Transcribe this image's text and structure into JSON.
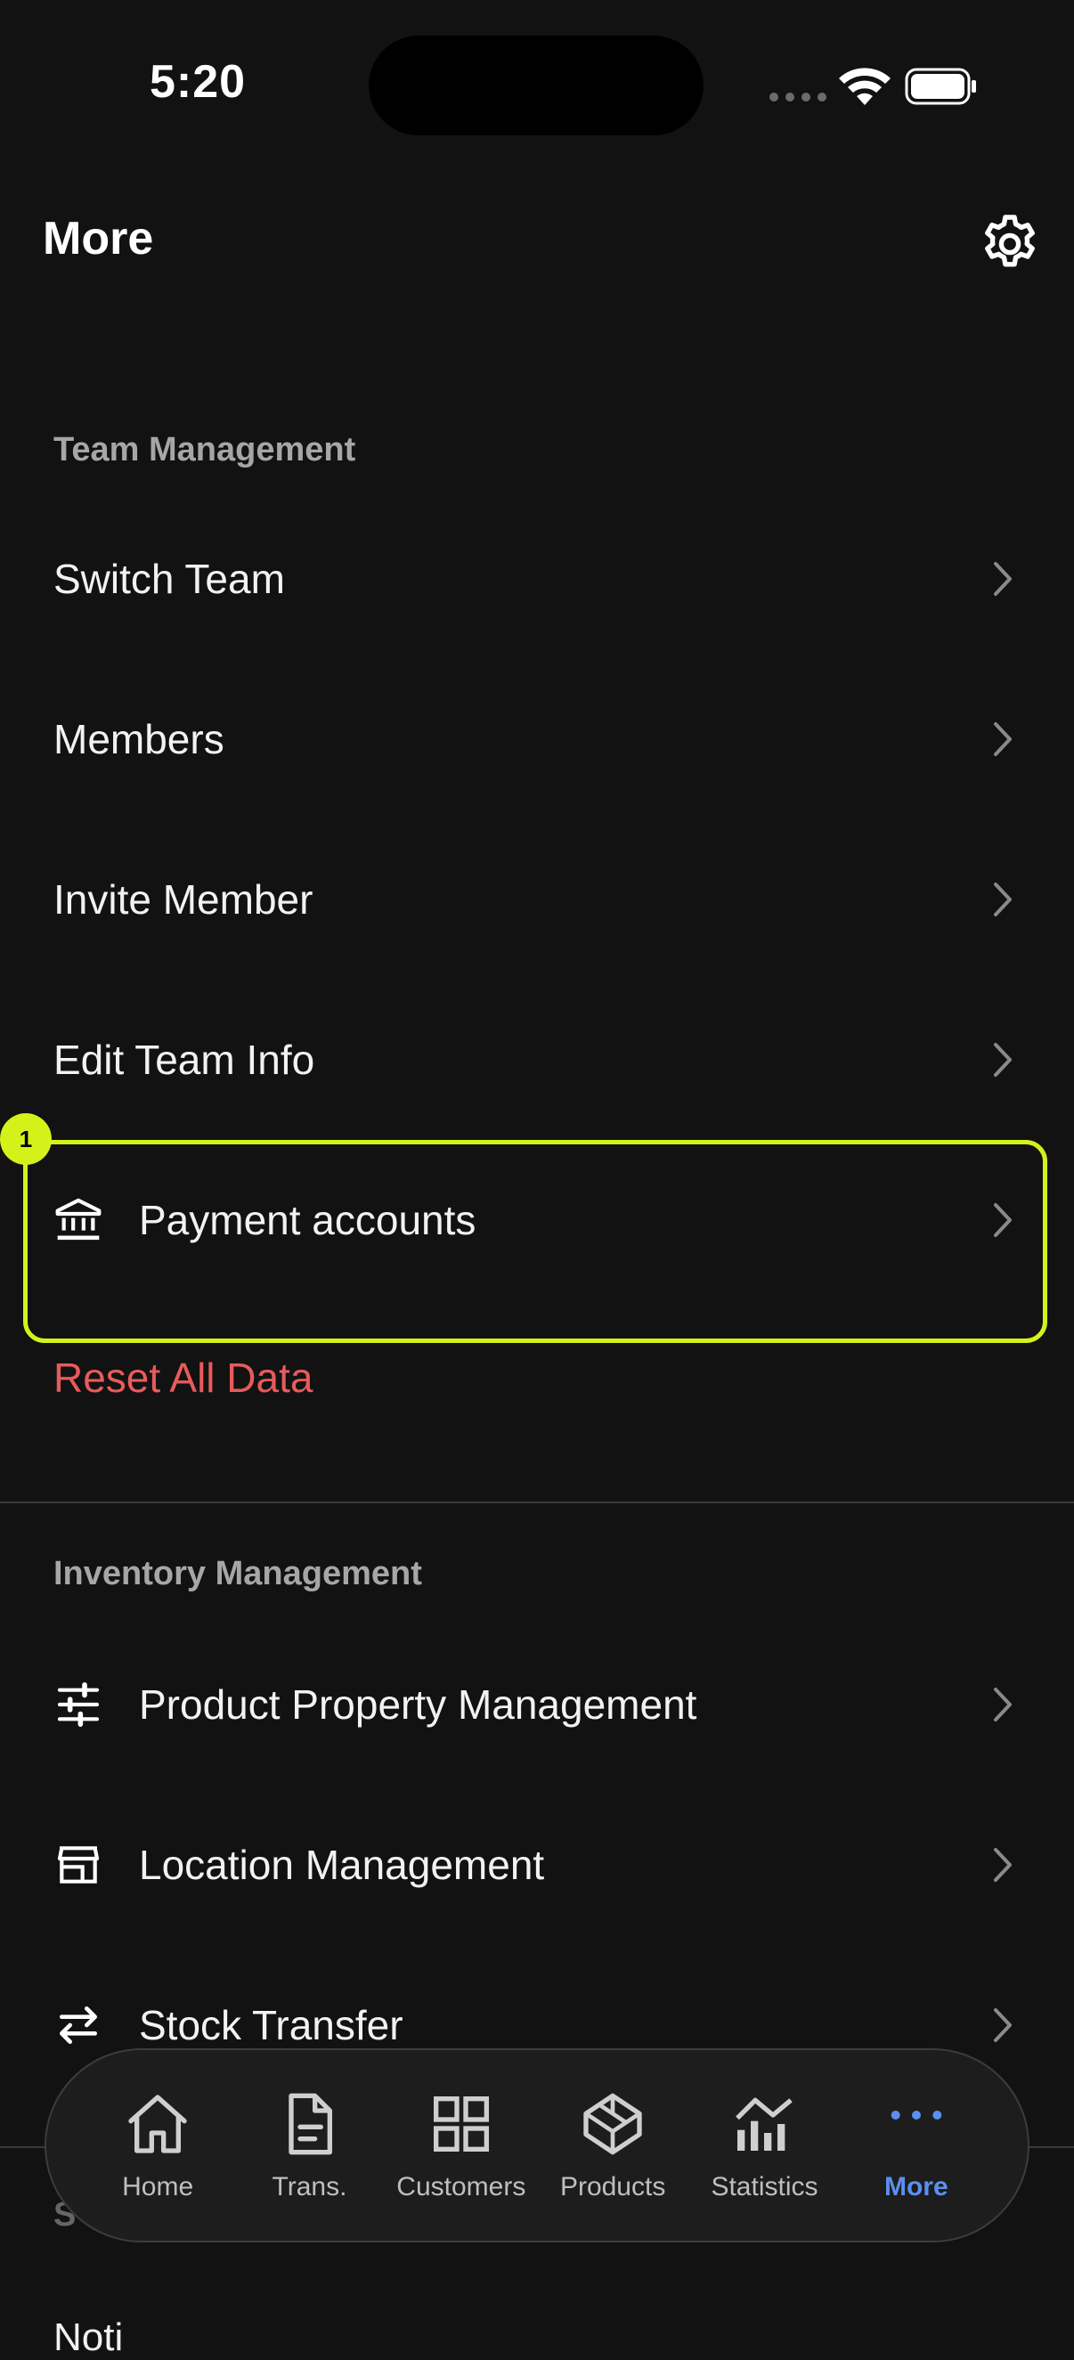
{
  "status_bar": {
    "time": "5:20"
  },
  "header": {
    "title": "More"
  },
  "team_management": {
    "header": "Team Management",
    "items": [
      {
        "label": "Switch Team"
      },
      {
        "label": "Members"
      },
      {
        "label": "Invite Member"
      },
      {
        "label": "Edit Team Info"
      },
      {
        "label": "Payment accounts",
        "icon": "bank-icon"
      }
    ],
    "reset_label": "Reset All Data"
  },
  "highlight": {
    "badge": "1"
  },
  "inventory_management": {
    "header": "Inventory Management",
    "items": [
      {
        "label": "Product Property Management",
        "icon": "sliders-icon"
      },
      {
        "label": "Location Management",
        "icon": "store-icon"
      },
      {
        "label": "Stock Transfer",
        "icon": "transfer-icon"
      }
    ]
  },
  "next_section": {
    "header_partial": "S",
    "item_partial": "Noti"
  },
  "tab_bar": {
    "items": [
      {
        "label": "Home",
        "icon": "home-icon"
      },
      {
        "label": "Trans.",
        "icon": "document-icon"
      },
      {
        "label": "Customers",
        "icon": "grid-icon"
      },
      {
        "label": "Products",
        "icon": "box-icon"
      },
      {
        "label": "Statistics",
        "icon": "chart-icon"
      },
      {
        "label": "More",
        "icon": "more-dots-icon",
        "active": true
      }
    ]
  },
  "colors": {
    "background": "#121212",
    "accent": "#5b8ff0",
    "danger": "#e85b5b",
    "highlight": "#d4f21a"
  }
}
